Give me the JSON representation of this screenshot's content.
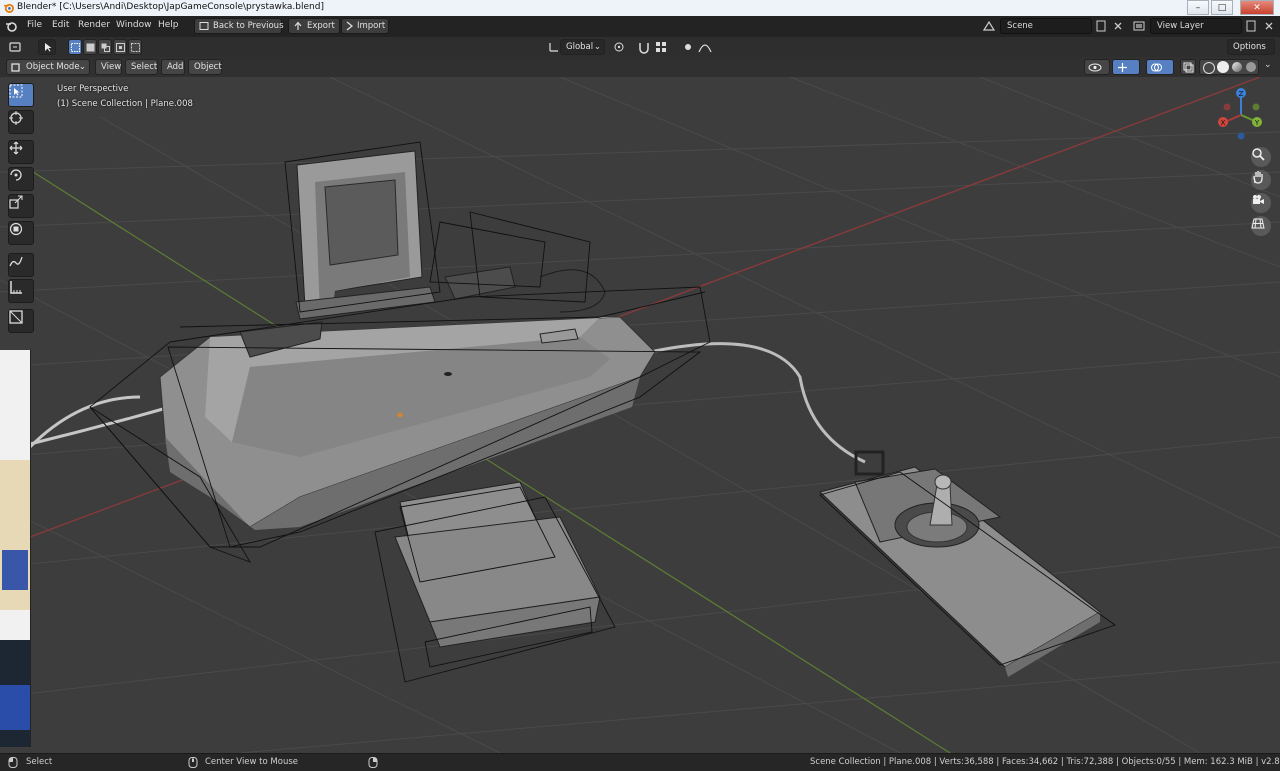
{
  "window": {
    "title": "Blender* [C:\\Users\\Andi\\Desktop\\JapGameConsole\\prystawka.blend]",
    "minimize": "–",
    "maximize": "□",
    "close": "✕"
  },
  "topbar": {
    "menus": [
      "File",
      "Edit",
      "Render",
      "Window",
      "Help"
    ],
    "back_label": "Back to Previous",
    "export_label": "Export",
    "import_label": "Import",
    "scene_name": "Scene",
    "view_layer": "View Layer"
  },
  "toolheader": {
    "orientation": "Global",
    "options": "Options"
  },
  "viewheader": {
    "mode": "Object Mode",
    "menus": [
      "View",
      "Select",
      "Add",
      "Object"
    ]
  },
  "viewport": {
    "perspective": "User Perspective",
    "collection": "(1) Scene Collection | Plane.008",
    "axes": {
      "z": "Z",
      "y": "Y",
      "x": "X"
    }
  },
  "statusbar": {
    "left_action": "Select",
    "middle_action": "Center View to Mouse",
    "stats": "Scene Collection | Plane.008 | Verts:36,588 | Faces:34,662 | Tris:72,388 | Objects:0/55 | Mem: 162.3 MiB | v2.81.16"
  },
  "colors": {
    "accent": "#5680c2",
    "x_axis": "#b03a3a",
    "y_axis": "#6b9a2c",
    "z_axis": "#3b80d9"
  }
}
